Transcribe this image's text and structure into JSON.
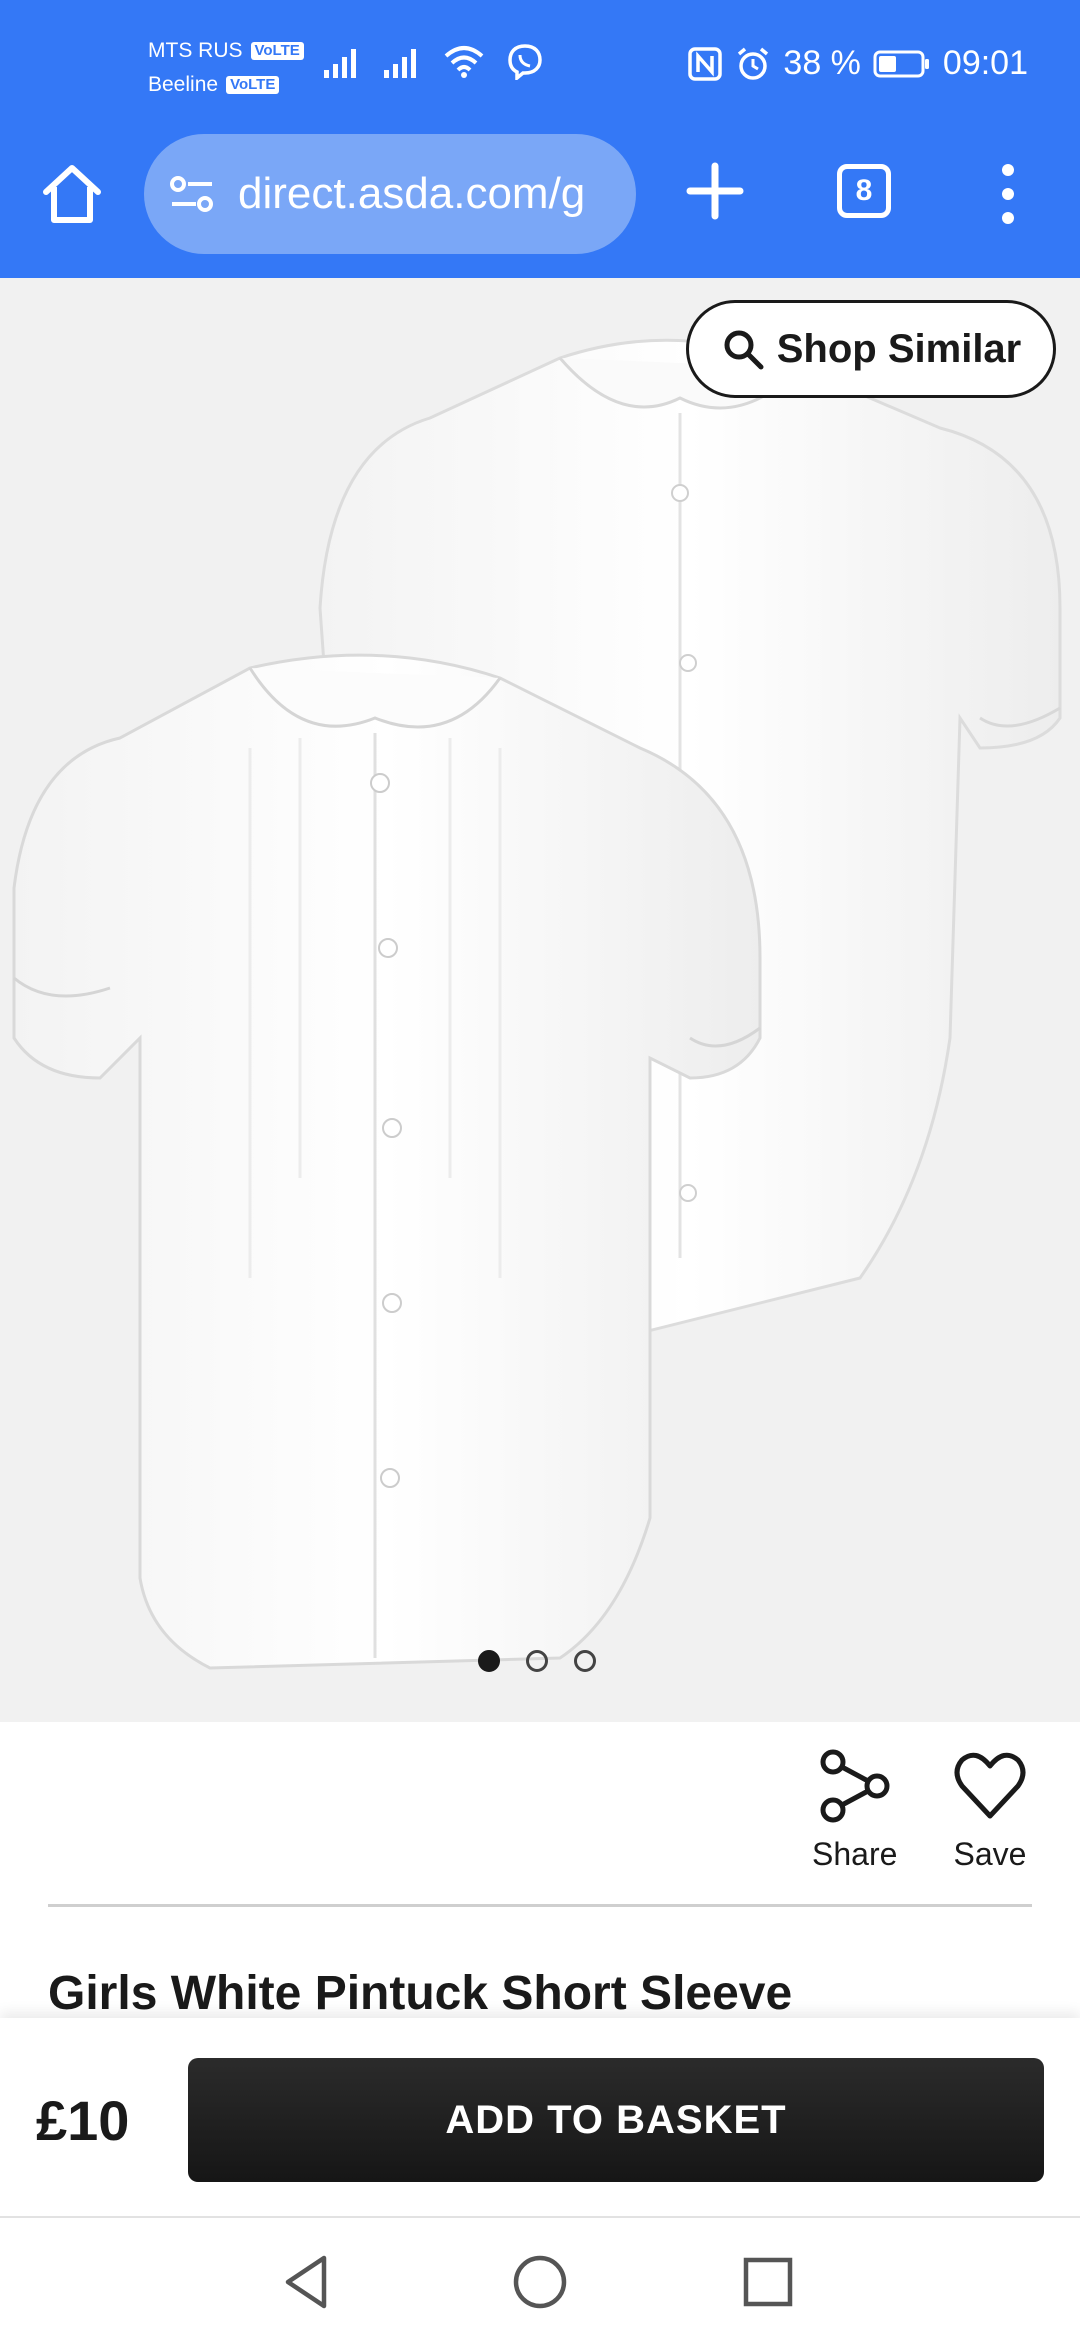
{
  "status_bar": {
    "carrier_1": "MTS RUS",
    "carrier_2": "Beeline",
    "volte_badge": "VoLTE",
    "battery": "38 %",
    "time": "09:01"
  },
  "browser": {
    "url": "direct.asda.com/g",
    "tab_count": "8"
  },
  "gallery": {
    "shop_similar_label": "Shop Similar",
    "image_count": 3,
    "active_index": 0
  },
  "actions": {
    "share_label": "Share",
    "save_label": "Save"
  },
  "product": {
    "title": "Girls White Pintuck Short Sleeve",
    "price": "£10",
    "add_to_basket_label": "ADD TO BASKET"
  },
  "icons": {
    "home": "home-icon",
    "site_settings": "site-settings-icon",
    "new_tab": "plus-icon",
    "tabs": "tab-switcher-icon",
    "menu": "more-vertical-icon",
    "search": "search-icon",
    "share": "share-icon",
    "save": "heart-icon",
    "back": "back-triangle-icon",
    "home_nav": "home-circle-icon",
    "recents": "recents-square-icon"
  },
  "colors": {
    "browser_blue": "#3478f6",
    "button_dark": "#1a1a1a"
  }
}
